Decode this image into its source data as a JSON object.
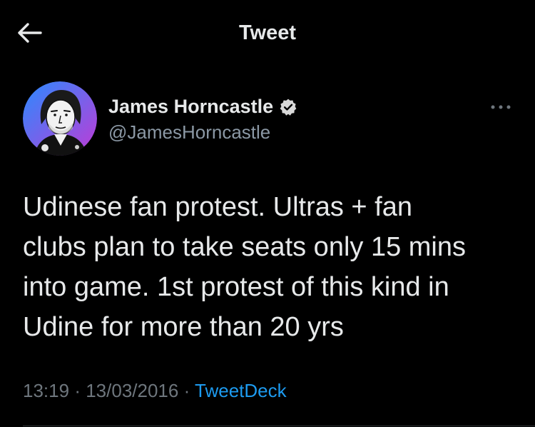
{
  "header": {
    "title": "Tweet",
    "back_icon": "arrow-left-icon"
  },
  "author": {
    "display_name": "James Horncastle",
    "handle": "@JamesHorncastle",
    "verified": true,
    "verified_icon": "verified-badge-icon"
  },
  "tweet": {
    "lines": [
      "Udinese fan protest. Ultras + fan",
      "clubs plan to take seats only 15 mins",
      "into game. 1st protest of this kind in",
      "Udine for more than 20 yrs"
    ],
    "time": "13:19",
    "separator": "·",
    "date": "13/03/2016",
    "source": "TweetDeck"
  },
  "menu": {
    "more_icon": "more-horizontal-icon"
  },
  "colors": {
    "background": "#000000",
    "text_primary": "#e7e9ea",
    "text_secondary": "#8b98a5",
    "accent": "#1d9bf0",
    "verified_badge": "#d9d9d9",
    "avatar_gradient_start": "#2a8bff",
    "avatar_gradient_end": "#c03ad6"
  }
}
